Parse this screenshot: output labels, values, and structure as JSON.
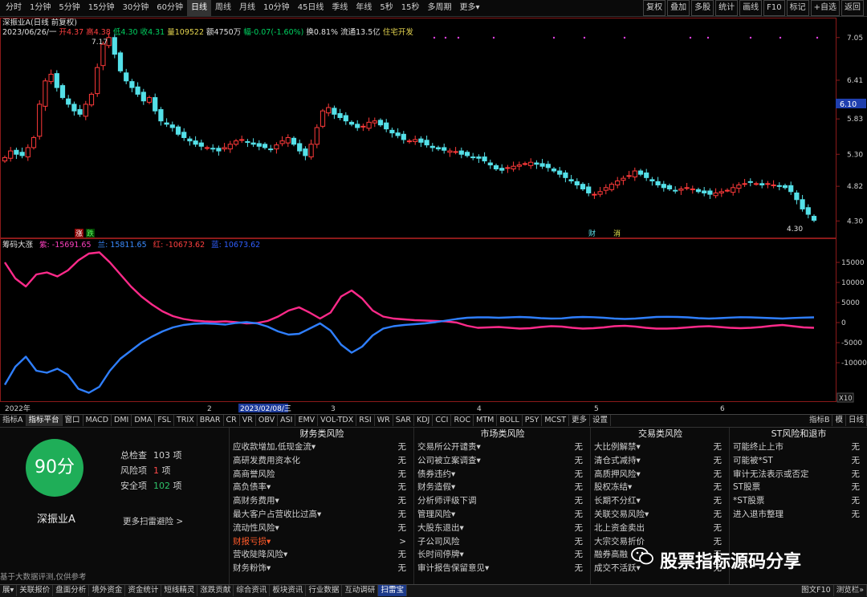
{
  "periods": [
    "分时",
    "1分钟",
    "5分钟",
    "15分钟",
    "30分钟",
    "60分钟",
    "日线",
    "周线",
    "月线",
    "10分钟",
    "45日线",
    "季线",
    "年线",
    "5秒",
    "15秒",
    "多周期",
    "更多▾"
  ],
  "active_period": "日线",
  "tools": [
    "复权",
    "叠加",
    "多股",
    "统计",
    "画线",
    "F10",
    "标记",
    "+自选",
    "返回"
  ],
  "stock_title": "深振业A",
  "title_suffix": "(日线 前复权)",
  "info_line": {
    "date": "2023/06/26/一",
    "open": "开4.37",
    "high": "高4.38",
    "low": "低4.30",
    "close": "收4.31",
    "volume": "量109522",
    "amount": "额4750万",
    "change": "幅-0.07(-1.60%)",
    "turnover": "换0.81%",
    "float": "流通13.5亿",
    "sector": "住宅开发"
  },
  "price_axis": [
    "7.05",
    "6.41",
    "5.83",
    "5.30",
    "4.82",
    "4.30"
  ],
  "price_current": "6.10",
  "label_max": "7.17",
  "label_min": "4.30",
  "markers": {
    "zhang": "涨",
    "die": "跌",
    "cai": "财",
    "xiao": "消"
  },
  "indicator_header": {
    "name": "筹码大涨",
    "zi": "紫: -15691.65",
    "lan": "兰: 15811.65",
    "hong": "红: -10673.62",
    "last": "蓝: 10673.62"
  },
  "ind_axis": [
    "15000",
    "10000",
    "5000",
    "0",
    "-5000",
    "-10000"
  ],
  "ind_unit": "X10",
  "time_labels": [
    "2022年",
    "2",
    "2023/02/08/三",
    "3",
    "4",
    "5",
    "6"
  ],
  "index_tabs": [
    "指标A",
    "指标平台",
    "窗口",
    "MACD",
    "DMI",
    "DMA",
    "FSL",
    "TRIX",
    "BRAR",
    "CR",
    "VR",
    "OBV",
    "ASI",
    "EMV",
    "VOL-TDX",
    "RSI",
    "WR",
    "SAR",
    "KDJ",
    "CCI",
    "ROC",
    "MTM",
    "BOLL",
    "PSY",
    "MCST",
    "更多",
    "设置"
  ],
  "index_right": [
    "指标B",
    "模",
    "日线"
  ],
  "panel": {
    "score": "90分",
    "stock_name": "深振业A",
    "total_label": "总检查",
    "total_value": "103",
    "total_unit": "项",
    "risk_label": "风险项",
    "risk_value": "1",
    "risk_unit": "项",
    "safe_label": "安全项",
    "safe_value": "102",
    "safe_unit": "项",
    "more_link": "更多扫雷避险 >",
    "note": "基于大数据评测,仅供参考",
    "columns": [
      {
        "title": "财务类风险",
        "items": [
          [
            "应收款增加,低现金流▾",
            "无"
          ],
          [
            "高研发费用资本化",
            "无"
          ],
          [
            "高商誉风险",
            "无"
          ],
          [
            "高负债率▾",
            "无"
          ],
          [
            "高财务费用▾",
            "无"
          ],
          [
            "最大客户占营收比过高▾",
            "无"
          ],
          [
            "流动性风险▾",
            "无"
          ],
          [
            "财报亏损▾",
            ">"
          ],
          [
            "营收陡降风险▾",
            "无"
          ],
          [
            "财务粉饰▾",
            "无"
          ]
        ]
      },
      {
        "title": "市场类风险",
        "items": [
          [
            "交易所公开谴责▾",
            "无"
          ],
          [
            "公司被立案调查▾",
            "无"
          ],
          [
            "债券违约▾",
            "无"
          ],
          [
            "财务造假▾",
            "无"
          ],
          [
            "分析师评级下调",
            "无"
          ],
          [
            "管理风险▾",
            "无"
          ],
          [
            "大股东退出▾",
            "无"
          ],
          [
            "子公司风险",
            "无"
          ],
          [
            "长时间停牌▾",
            "无"
          ],
          [
            "审计报告保留意见▾",
            "无"
          ]
        ]
      },
      {
        "title": "交易类风险",
        "items": [
          [
            "大比例解禁▾",
            "无"
          ],
          [
            "清仓式减持▾",
            "无"
          ],
          [
            "高质押风险▾",
            "无"
          ],
          [
            "股权冻结▾",
            "无"
          ],
          [
            "长期不分红▾",
            "无"
          ],
          [
            "关联交易风险▾",
            "无"
          ],
          [
            "北上资金卖出",
            "无"
          ],
          [
            "大宗交易折价",
            "无"
          ],
          [
            "融券高融",
            "无"
          ],
          [
            "成交不活跃▾",
            "无"
          ]
        ]
      },
      {
        "title": "ST风险和退市",
        "items": [
          [
            "可能终止上市",
            "无"
          ],
          [
            "可能被*ST",
            "无"
          ],
          [
            "审计无法表示或否定",
            "无"
          ],
          [
            "ST股票",
            "无"
          ],
          [
            "*ST股票",
            "无"
          ],
          [
            "进入退市整理",
            "无"
          ]
        ]
      }
    ]
  },
  "status_tabs": [
    "展▾",
    "关联报价",
    "盘面分析",
    "境外资金",
    "资金统计",
    "短线精灵",
    "涨跌贡献",
    "综合资讯",
    "板块资讯",
    "行业数据",
    "互动调研",
    "扫雷宝"
  ],
  "status_active": "扫雷宝",
  "status_right": [
    "图文F10",
    "测览栏»"
  ],
  "watermark": "股票指标源码分享",
  "colors": {
    "up": "#ff3a3a",
    "down": "#54e0e8",
    "magenta": "#ff2a8a",
    "blue": "#2f7fff",
    "score_bg": "#1fae58"
  },
  "chart_data": {
    "type": "candlestick",
    "symbol": "深振业A",
    "period": "日线",
    "x_range": [
      "2022-12",
      "2023-06-26"
    ],
    "ylim": [
      4.1,
      7.3
    ],
    "closes": [
      5.25,
      5.35,
      5.3,
      5.28,
      5.4,
      5.55,
      6.05,
      6.4,
      6.5,
      6.3,
      6.15,
      6.05,
      5.95,
      5.9,
      6.05,
      6.2,
      6.6,
      6.95,
      7.05,
      6.8,
      6.55,
      6.4,
      6.3,
      6.2,
      6.1,
      6.15,
      5.95,
      5.8,
      5.75,
      5.7,
      5.6,
      5.55,
      5.5,
      5.45,
      5.42,
      5.4,
      5.38,
      5.35,
      5.4,
      5.45,
      5.5,
      5.52,
      5.48,
      5.45,
      5.42,
      5.4,
      5.38,
      5.44,
      5.5,
      5.55,
      5.45,
      5.35,
      5.28,
      5.45,
      5.7,
      5.95,
      6.0,
      5.9,
      5.85,
      5.8,
      5.75,
      5.7,
      5.72,
      5.78,
      5.8,
      5.74,
      5.68,
      5.62,
      5.58,
      5.52,
      5.5,
      5.52,
      5.48,
      5.44,
      5.4,
      5.38,
      5.36,
      5.35,
      5.34,
      5.3,
      5.28,
      5.26,
      5.24,
      5.2,
      5.14,
      5.08,
      5.06,
      5.1,
      5.12,
      5.14,
      5.16,
      5.18,
      5.15,
      5.12,
      5.1,
      5.05,
      5.0,
      4.95,
      4.9,
      4.84,
      4.78,
      4.72,
      4.7,
      4.74,
      4.8,
      4.85,
      4.9,
      4.94,
      4.98,
      5.05,
      5.0,
      4.95,
      4.9,
      4.84,
      4.8,
      4.78,
      4.76,
      4.78,
      4.8,
      4.78,
      4.74,
      4.72,
      4.7,
      4.72,
      4.74,
      4.76,
      4.8,
      4.84,
      4.86,
      4.88,
      4.86,
      4.84,
      4.86,
      4.84,
      4.82,
      4.8,
      4.74,
      4.62,
      4.48,
      4.4,
      4.31
    ]
  },
  "indicator_data": {
    "type": "line",
    "ylim": [
      -18000,
      18000
    ],
    "series": [
      {
        "name": "紫",
        "values": [
          15000,
          11000,
          9000,
          12000,
          12500,
          11500,
          13000,
          15500,
          17200,
          17500,
          15000,
          12000,
          9000,
          6500,
          4500,
          2800,
          1600,
          900,
          500,
          300,
          200,
          300,
          100,
          -200,
          -100,
          400,
          1500,
          3000,
          3800,
          2500,
          1000,
          2500,
          6500,
          8000,
          6000,
          3000,
          1500,
          1000,
          800,
          600,
          500,
          400,
          300,
          0,
          -800,
          -1300,
          -1200,
          -1100,
          -1300,
          -1500,
          -1400,
          -1100,
          -900,
          -1000,
          -1300,
          -1500,
          -1400,
          -1200,
          -900,
          -800,
          -1000,
          -1300,
          -1500,
          -1500,
          -1400,
          -1200,
          -1000,
          -900,
          -1100,
          -1300,
          -1400,
          -1300,
          -1100,
          -800,
          -600,
          -900,
          -1200,
          -1300
        ]
      },
      {
        "name": "兰",
        "values": [
          -15500,
          -11000,
          -8500,
          -12000,
          -12500,
          -11500,
          -13000,
          -16500,
          -17500,
          -16000,
          -12000,
          -9000,
          -7000,
          -5000,
          -3500,
          -2200,
          -1200,
          -600,
          -300,
          -200,
          -300,
          -500,
          -100,
          100,
          -200,
          -1000,
          -2200,
          -3000,
          -2800,
          -1500,
          -200,
          -2000,
          -5500,
          -7500,
          -6000,
          -3200,
          -1500,
          -900,
          -600,
          -400,
          -200,
          100,
          500,
          900,
          1200,
          1300,
          1300,
          1200,
          1300,
          1400,
          1300,
          1100,
          1000,
          1050,
          1300,
          1400,
          1350,
          1200,
          1000,
          900,
          1000,
          1200,
          1400,
          1450,
          1400,
          1300,
          1100,
          1000,
          1100,
          1250,
          1350,
          1300,
          1200,
          1100,
          1000,
          1150,
          1250,
          1300
        ]
      }
    ]
  }
}
